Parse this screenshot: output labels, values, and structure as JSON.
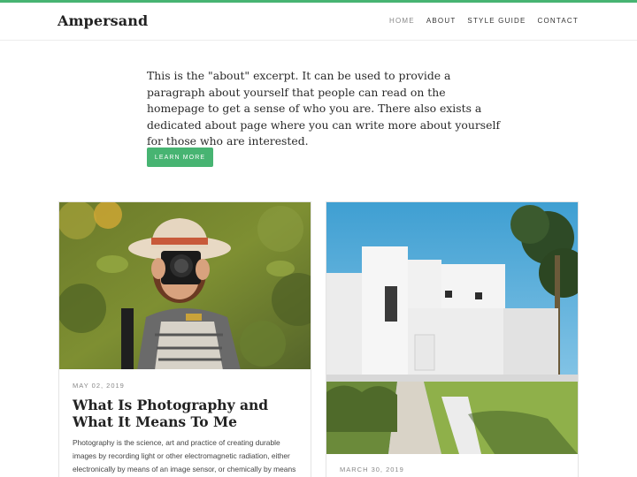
{
  "site": {
    "logo": "Ampersand"
  },
  "nav": {
    "items": [
      "Home",
      "About",
      "Style Guide",
      "Contact"
    ]
  },
  "intro": {
    "text": "This is the \"about\" excerpt. It can be used to provide a paragraph about yourself that people can read on the homepage to get a sense of who you are. There also exists a dedicated about page where you can write more about yourself for those who are interested.",
    "button_label": "Learn More"
  },
  "posts": [
    {
      "date": "May 02, 2019",
      "title": "What Is Photography and What It Means To Me",
      "excerpt": "Photography is the science, art and practice of creating durable images by recording light or other electromagnetic radiation, either electronically by means of an image sensor, or chemically by means of a light-sensitive material such as photographic film."
    },
    {
      "date": "March 30, 2019"
    }
  ],
  "colors": {
    "accent": "#47b472"
  }
}
